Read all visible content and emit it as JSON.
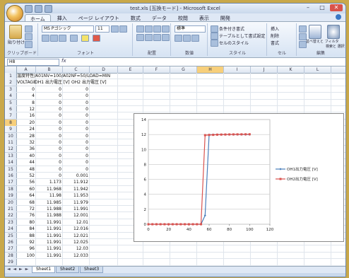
{
  "window": {
    "title": "test.xls [互換モード] - Microsoft Excel",
    "controls": [
      "–",
      "□",
      "✕"
    ]
  },
  "ribbon": {
    "tabs": [
      "ホーム",
      "挿入",
      "ページ レイアウト",
      "数式",
      "データ",
      "校閲",
      "表示",
      "開発"
    ],
    "groups": {
      "clipboard": {
        "label": "クリップボード",
        "paste": "貼り付け"
      },
      "font": {
        "label": "フォント",
        "name": "MS Pゴシック",
        "size": "11"
      },
      "alignment": {
        "label": "配置"
      },
      "number": {
        "label": "数値",
        "format": "標準"
      },
      "styles": {
        "label": "スタイル",
        "items": [
          "条件付き書式",
          "テーブルとして書式設定",
          "セルのスタイル"
        ]
      },
      "cells": {
        "label": "セル",
        "items": [
          "挿入",
          "削除",
          "書式"
        ]
      },
      "editing": {
        "label": "編集",
        "items": [
          "並べ替えと フィルタ",
          "検索と 選択"
        ]
      }
    }
  },
  "formula_bar": {
    "name_box": "H8",
    "fx": "fx",
    "value": ""
  },
  "grid": {
    "columns": [
      "A",
      "B",
      "C",
      "D",
      "E",
      "F",
      "G",
      "H",
      "I",
      "J",
      "K",
      "L"
    ],
    "selected_column": "H",
    "selected_row": "8",
    "rows": [
      "1",
      "2",
      "3",
      "4",
      "5",
      "6",
      "7",
      "8",
      "9",
      "10",
      "11",
      "12",
      "13",
      "14",
      "15",
      "16",
      "17",
      "18",
      "19",
      "20",
      "21",
      "22",
      "23",
      "24",
      "25",
      "26",
      "27",
      "28",
      "29"
    ],
    "row1_text": "温度特性/A01NV=100/A02NF=50/LOAD=MIN",
    "row2": [
      "VOLTAGE",
      "OH1 出力電圧 [V]",
      "OH2 出力電圧 [V]"
    ],
    "data": [
      [
        "0",
        "0",
        "0"
      ],
      [
        "4",
        "0",
        "0"
      ],
      [
        "8",
        "0",
        "0"
      ],
      [
        "12",
        "0",
        "0"
      ],
      [
        "16",
        "0",
        "0"
      ],
      [
        "20",
        "0",
        "0"
      ],
      [
        "24",
        "0",
        "0"
      ],
      [
        "28",
        "0",
        "0"
      ],
      [
        "32",
        "0",
        "0"
      ],
      [
        "36",
        "0",
        "0"
      ],
      [
        "40",
        "0",
        "0"
      ],
      [
        "44",
        "0",
        "0"
      ],
      [
        "48",
        "0",
        "0"
      ],
      [
        "52",
        "0",
        "0.001"
      ],
      [
        "56",
        "1.173",
        "11.912"
      ],
      [
        "60",
        "11.968",
        "11.942"
      ],
      [
        "64",
        "11.98",
        "11.953"
      ],
      [
        "68",
        "11.985",
        "11.979"
      ],
      [
        "72",
        "11.988",
        "11.991"
      ],
      [
        "76",
        "11.988",
        "12.001"
      ],
      [
        "80",
        "11.991",
        "12.01"
      ],
      [
        "84",
        "11.991",
        "12.016"
      ],
      [
        "88",
        "11.991",
        "12.021"
      ],
      [
        "92",
        "11.991",
        "12.025"
      ],
      [
        "96",
        "11.991",
        "12.03"
      ],
      [
        "100",
        "11.991",
        "12.033"
      ]
    ]
  },
  "chart_data": {
    "type": "line",
    "title": "",
    "xlim": [
      0,
      120
    ],
    "ylim": [
      0,
      14
    ],
    "xticks": [
      "0",
      "20",
      "40",
      "60",
      "80",
      "100",
      "120"
    ],
    "yticks": [
      "0",
      "2",
      "4",
      "6",
      "8",
      "10",
      "12",
      "14"
    ],
    "legend_position": "right",
    "x": [
      0,
      4,
      8,
      12,
      16,
      20,
      24,
      28,
      32,
      36,
      40,
      44,
      48,
      52,
      56,
      60,
      64,
      68,
      72,
      76,
      80,
      84,
      88,
      92,
      96,
      100
    ],
    "series": [
      {
        "name": "OH1出力電圧 [V]",
        "color": "#4a7ebb",
        "values": [
          0,
          0,
          0,
          0,
          0,
          0,
          0,
          0,
          0,
          0,
          0,
          0,
          0,
          0,
          1.173,
          11.968,
          11.98,
          11.985,
          11.988,
          11.988,
          11.991,
          11.991,
          11.991,
          11.991,
          11.991,
          11.991
        ]
      },
      {
        "name": "OH2出力電圧 [V]",
        "color": "#d9534f",
        "values": [
          0,
          0,
          0,
          0,
          0,
          0,
          0,
          0,
          0,
          0,
          0,
          0,
          0,
          0.001,
          11.912,
          11.942,
          11.953,
          11.979,
          11.991,
          12.001,
          12.01,
          12.016,
          12.021,
          12.025,
          12.03,
          12.033
        ]
      }
    ]
  },
  "sheets": [
    "Sheet1",
    "Sheet2",
    "Sheet3"
  ],
  "active_sheet": "Sheet1",
  "sheet_nav": "◄ ◄ ► ►"
}
